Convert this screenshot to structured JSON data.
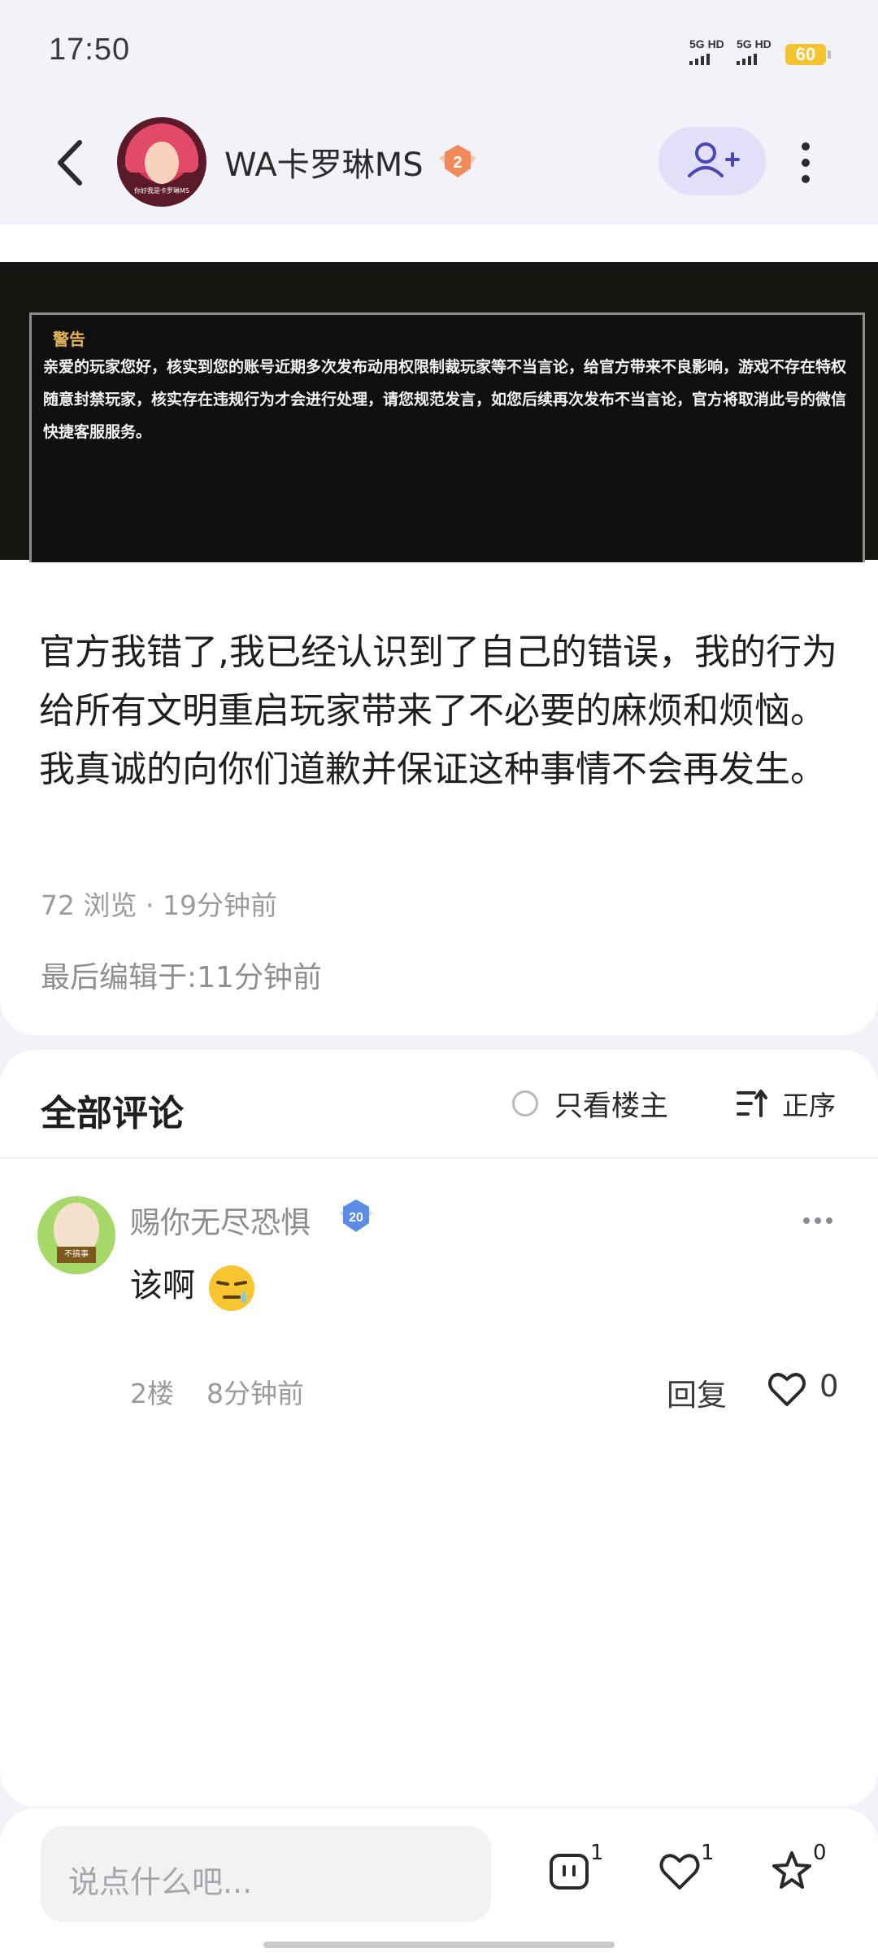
{
  "status": {
    "time": "17:50",
    "sim1": "5G HD",
    "sim2": "5G HD",
    "battery": "60"
  },
  "header": {
    "username": "WA卡罗琳MS",
    "level": "2",
    "avatar_caption": "你好我是卡罗琳MS"
  },
  "post": {
    "image": {
      "warning_title": "警告",
      "warning_text": "亲爱的玩家您好，核实到您的账号近期多次发布动用权限制裁玩家等不当言论，给官方带来不良影响，游戏不存在特权随意封禁玩家，核实存在违规行为才会进行处理，请您规范发言，如您后续再次发布不当言论，官方将取消此号的微信快捷客服服务。"
    },
    "text": "官方我错了,我已经认识到了自己的错误，我的行为给所有文明重启玩家带来了不必要的麻烦和烦恼。我真诚的向你们道歉并保证这种事情不会再发生。",
    "meta": "72 浏览 · 19分钟前",
    "edited": "最后编辑于:11分钟前"
  },
  "comments": {
    "title": "全部评论",
    "only_owner": "只看楼主",
    "order": "正序",
    "items": [
      {
        "name": "赐你无尽恐惧",
        "level": "20",
        "avatar_sign": "不搞事",
        "text": "该啊",
        "floor": "2楼",
        "time": "8分钟前",
        "reply": "回复",
        "likes": "0"
      }
    ]
  },
  "bottom": {
    "placeholder": "说点什么吧...",
    "comment_count": "1",
    "like_count": "1",
    "fav_count": "0"
  },
  "colors": {
    "accent_bg": "#e2e0f8",
    "accent": "#5a55c9",
    "muted": "#9a9ba0"
  }
}
